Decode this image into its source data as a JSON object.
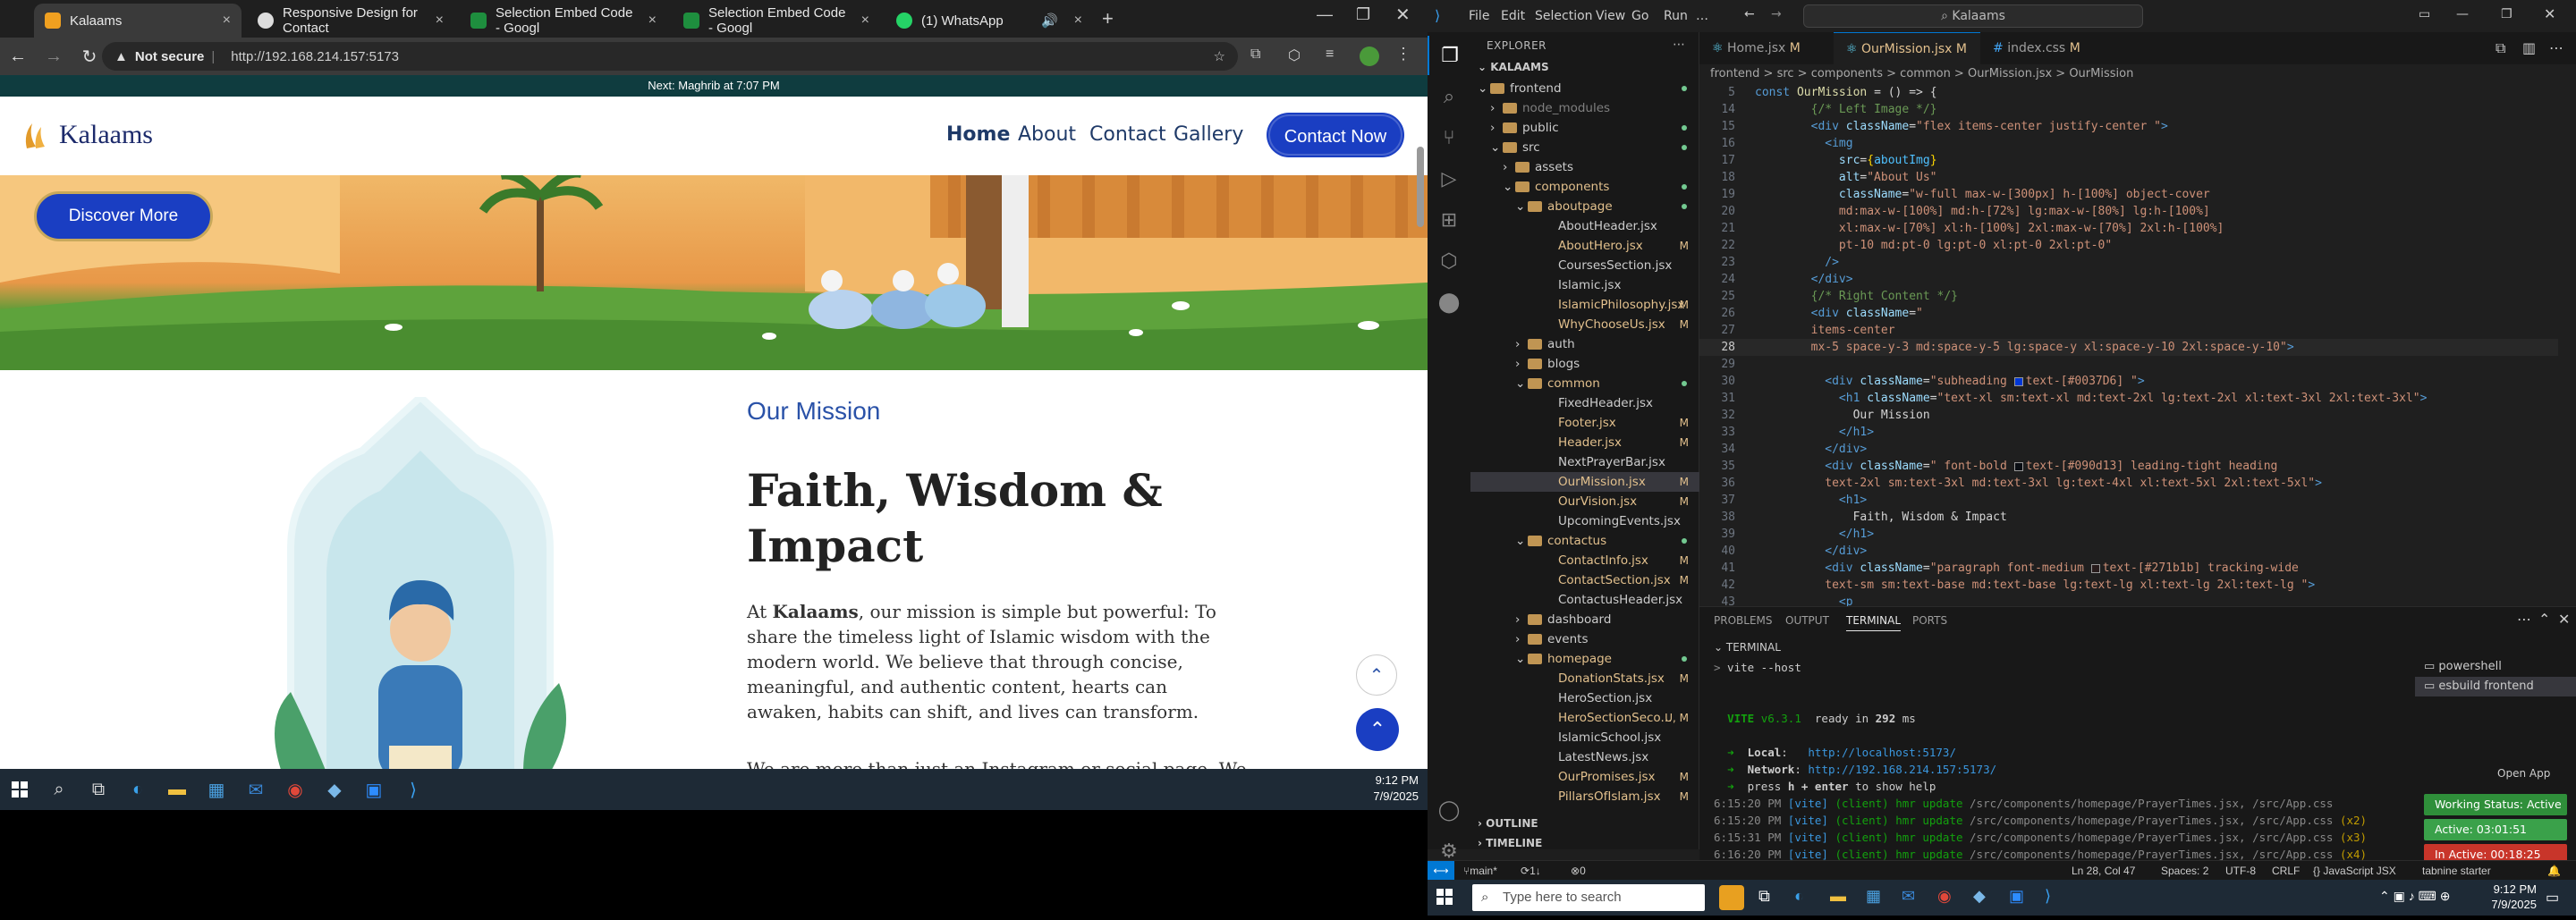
{
  "browser": {
    "tabs": [
      {
        "label": "Kalaams",
        "active": true
      },
      {
        "label": "Responsive Design for Contact",
        "active": false
      },
      {
        "label": "Selection Embed Code - Googl",
        "active": false
      },
      {
        "label": "Selection Embed Code - Googl",
        "active": false
      },
      {
        "label": "(1) WhatsApp",
        "active": false
      }
    ],
    "security": "Not secure",
    "url": "http://192.168.214.157:5173"
  },
  "site": {
    "prayer_bar": "Next: Maghrib at 7:07 PM",
    "logo": "Kalaams",
    "nav": [
      "Home",
      "About",
      "Contact",
      "Gallery"
    ],
    "cta": "Contact Now",
    "hero_button": "Discover More",
    "mission": {
      "tag": "Our Mission",
      "heading": "Faith, Wisdom & Impact",
      "para_prefix": "At ",
      "para_brand": "Kalaams",
      "para_rest": ", our mission is simple but powerful: To share the timeless light of Islamic wisdom with the modern world. We believe that through concise, meaningful, and authentic content, hearts can awaken, habits can shift, and lives can transform.",
      "para2": "We are more than just an Instagram or social page. We are a"
    }
  },
  "taskbar_left": {
    "time": "9:12 PM",
    "date": "7/9/2025"
  },
  "vscode": {
    "menu": [
      "File",
      "Edit",
      "Selection",
      "View",
      "Go",
      "Run",
      "…"
    ],
    "search": "Kalaams",
    "explorer_title": "EXPLORER",
    "workspace": "KALAAMS",
    "tree": [
      {
        "label": "frontend",
        "depth": 0,
        "kind": "folder-open",
        "dot": true
      },
      {
        "label": "node_modules",
        "depth": 1,
        "kind": "folder",
        "dim": true
      },
      {
        "label": "public",
        "depth": 1,
        "kind": "folder",
        "dot": true
      },
      {
        "label": "src",
        "depth": 1,
        "kind": "folder-open",
        "dot": true
      },
      {
        "label": "assets",
        "depth": 2,
        "kind": "folder"
      },
      {
        "label": "components",
        "depth": 2,
        "kind": "folder-open",
        "dot": true,
        "mod": true
      },
      {
        "label": "aboutpage",
        "depth": 3,
        "kind": "folder-open",
        "dot": true,
        "mod": true
      },
      {
        "label": "AboutHeader.jsx",
        "depth": 4,
        "kind": "file"
      },
      {
        "label": "AboutHero.jsx",
        "depth": 4,
        "kind": "file",
        "m": "M",
        "mod": true
      },
      {
        "label": "CoursesSection.jsx",
        "depth": 4,
        "kind": "file"
      },
      {
        "label": "Islamic.jsx",
        "depth": 4,
        "kind": "file"
      },
      {
        "label": "IslamicPhilosophy.jsx",
        "depth": 4,
        "kind": "file",
        "m": "M",
        "mod": true
      },
      {
        "label": "WhyChooseUs.jsx",
        "depth": 4,
        "kind": "file",
        "m": "M",
        "mod": true
      },
      {
        "label": "auth",
        "depth": 3,
        "kind": "folder"
      },
      {
        "label": "blogs",
        "depth": 3,
        "kind": "folder"
      },
      {
        "label": "common",
        "depth": 3,
        "kind": "folder-open",
        "dot": true,
        "mod": true
      },
      {
        "label": "FixedHeader.jsx",
        "depth": 4,
        "kind": "file"
      },
      {
        "label": "Footer.jsx",
        "depth": 4,
        "kind": "file",
        "m": "M",
        "mod": true
      },
      {
        "label": "Header.jsx",
        "depth": 4,
        "kind": "file",
        "m": "M",
        "mod": true
      },
      {
        "label": "NextPrayerBar.jsx",
        "depth": 4,
        "kind": "file"
      },
      {
        "label": "OurMission.jsx",
        "depth": 4,
        "kind": "file",
        "m": "M",
        "mod": true,
        "sel": true
      },
      {
        "label": "OurVision.jsx",
        "depth": 4,
        "kind": "file",
        "m": "M",
        "mod": true
      },
      {
        "label": "UpcomingEvents.jsx",
        "depth": 4,
        "kind": "file"
      },
      {
        "label": "contactus",
        "depth": 3,
        "kind": "folder-open",
        "dot": true,
        "mod": true
      },
      {
        "label": "ContactInfo.jsx",
        "depth": 4,
        "kind": "file",
        "m": "M",
        "mod": true
      },
      {
        "label": "ContactSection.jsx",
        "depth": 4,
        "kind": "file",
        "m": "M",
        "mod": true
      },
      {
        "label": "ContactusHeader.jsx",
        "depth": 4,
        "kind": "file"
      },
      {
        "label": "dashboard",
        "depth": 3,
        "kind": "folder"
      },
      {
        "label": "events",
        "depth": 3,
        "kind": "folder"
      },
      {
        "label": "homepage",
        "depth": 3,
        "kind": "folder-open",
        "dot": true,
        "mod": true
      },
      {
        "label": "DonationStats.jsx",
        "depth": 4,
        "kind": "file",
        "m": "M",
        "mod": true
      },
      {
        "label": "HeroSection.jsx",
        "depth": 4,
        "kind": "file"
      },
      {
        "label": "HeroSectionSeco...",
        "depth": 4,
        "kind": "file",
        "m": "U, M",
        "mod": true
      },
      {
        "label": "IslamicSchool.jsx",
        "depth": 4,
        "kind": "file"
      },
      {
        "label": "LatestNews.jsx",
        "depth": 4,
        "kind": "file"
      },
      {
        "label": "OurPromises.jsx",
        "depth": 4,
        "kind": "file",
        "m": "M",
        "mod": true
      },
      {
        "label": "PillarsOfIslam.jsx",
        "depth": 4,
        "kind": "file",
        "m": "M",
        "mod": true
      }
    ],
    "outline": "OUTLINE",
    "timeline": "TIMELINE",
    "editor_tabs": [
      {
        "label": "Home.jsx",
        "m": "M"
      },
      {
        "label": "OurMission.jsx",
        "m": "M",
        "active": true
      },
      {
        "label": "index.css",
        "m": "M"
      }
    ],
    "breadcrumb": "frontend > src > components > common > OurMission.jsx > OurMission",
    "code_start_line": 5,
    "panel_tabs": [
      "PROBLEMS",
      "OUTPUT",
      "TERMINAL",
      "PORTS"
    ],
    "terminal_header": "TERMINAL",
    "terminal_side": [
      "powershell",
      "esbuild  frontend"
    ],
    "open_app": "Open App",
    "badges": {
      "working": "Working Status: Active",
      "active": "Active: 03:01:51",
      "inactive": "In Active: 00:18:25"
    },
    "status": {
      "branch": "main*",
      "sync": "1↓ 1↑",
      "problems": "0 ⚠ 0",
      "pos": "Ln 28, Col 47",
      "spaces": "Spaces: 2",
      "enc": "UTF-8",
      "eol": "CRLF",
      "lang": "{} JavaScript JSX",
      "tabnine": "tabnine starter"
    }
  },
  "taskbar_right": {
    "search_placeholder": "Type here to search",
    "time": "9:12 PM",
    "date": "7/9/2025"
  }
}
